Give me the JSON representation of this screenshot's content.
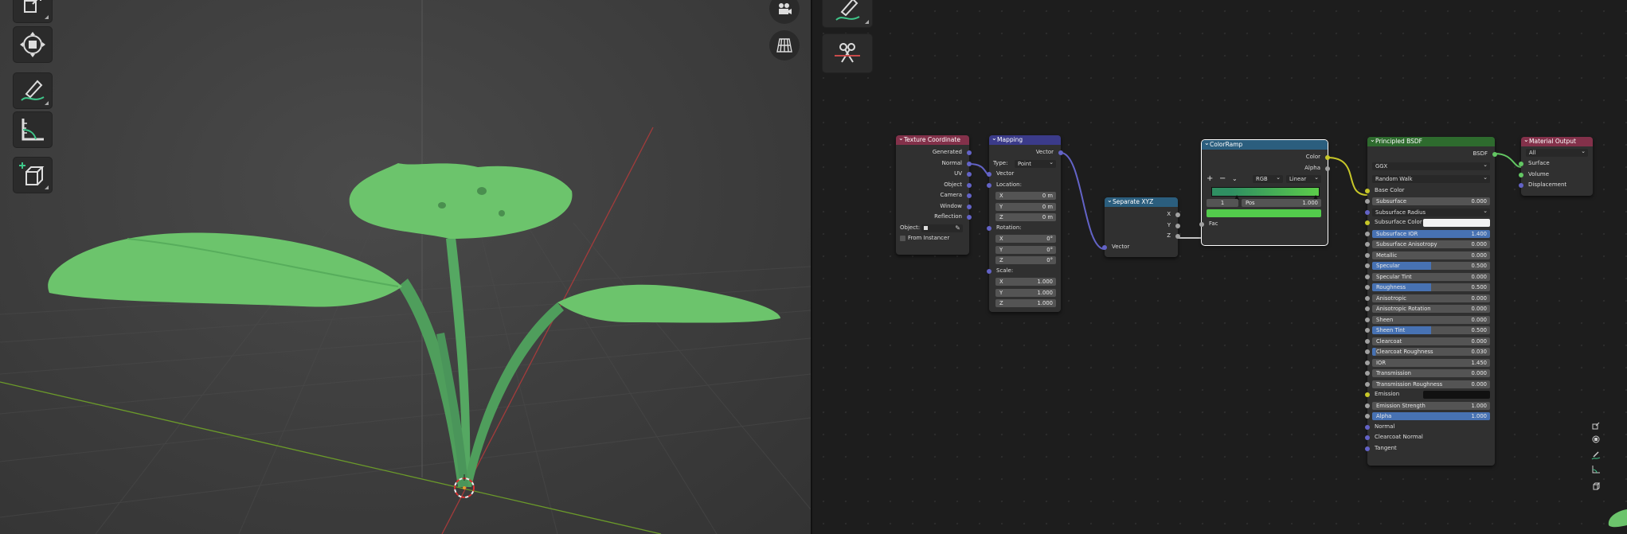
{
  "viewport": {
    "tools": [
      "scale-tool",
      "transform-tool",
      "annotate-tool",
      "measure-tool",
      "add-cube-tool"
    ],
    "nav": [
      "camera-view",
      "perspective-toggle"
    ],
    "colors": {
      "leaf": "#6cc46c",
      "x_axis": "#a33b3b",
      "y_axis": "#6b9a2a",
      "background": "#3d3d3d"
    }
  },
  "node_editor": {
    "texture_coordinate": {
      "title": "Texture Coordinate",
      "outputs": [
        "Generated",
        "Normal",
        "UV",
        "Object",
        "Camera",
        "Window",
        "Reflection"
      ],
      "object_label": "Object:",
      "from_instancer": "From Instancer"
    },
    "mapping": {
      "title": "Mapping",
      "output": "Vector",
      "type_label": "Type:",
      "type_value": "Point",
      "vector_in": "Vector",
      "location_label": "Location:",
      "location": [
        {
          "axis": "X",
          "value": "0 m"
        },
        {
          "axis": "Y",
          "value": "0 m"
        },
        {
          "axis": "Z",
          "value": "0 m"
        }
      ],
      "rotation_label": "Rotation:",
      "rotation": [
        {
          "axis": "X",
          "value": "0°"
        },
        {
          "axis": "Y",
          "value": "0°"
        },
        {
          "axis": "Z",
          "value": "0°"
        }
      ],
      "scale_label": "Scale:",
      "scale": [
        {
          "axis": "X",
          "value": "1.000"
        },
        {
          "axis": "Y",
          "value": "1.000"
        },
        {
          "axis": "Z",
          "value": "1.000"
        }
      ]
    },
    "separate_xyz": {
      "title": "Separate XYZ",
      "outputs": [
        "X",
        "Y",
        "Z"
      ],
      "input": "Vector"
    },
    "color_ramp": {
      "title": "ColorRamp",
      "outputs": [
        "Color",
        "Alpha"
      ],
      "add": "+",
      "remove": "−",
      "color_mode": "RGB",
      "interpolation": "Linear",
      "stop_index": "1",
      "pos_label": "Pos",
      "pos_value": "1.000",
      "input": "Fac",
      "colors": {
        "ramp_start": "#2f8f62",
        "ramp_end": "#5ccc4a",
        "swatch": "#53cc4c"
      }
    },
    "principled_bsdf": {
      "title": "Principled BSDF",
      "output": "BSDF",
      "distribution": "GGX",
      "subsurface_method": "Random Walk",
      "params": [
        {
          "label": "Base Color",
          "value": "",
          "fill": 0,
          "kind": "plain",
          "sock": "yellow"
        },
        {
          "label": "Subsurface",
          "value": "0.000",
          "fill": 0,
          "kind": "field",
          "sock": "grey"
        },
        {
          "label": "Subsurface Radius",
          "value": "",
          "fill": 0,
          "kind": "dropdown",
          "sock": "purple"
        },
        {
          "label": "Subsurface Color",
          "value": "",
          "fill": 0,
          "kind": "color",
          "sock": "yellow"
        },
        {
          "label": "Subsurface IOR",
          "value": "1.400",
          "fill": 1,
          "kind": "field",
          "sock": "grey"
        },
        {
          "label": "Subsurface Anisotropy",
          "value": "0.000",
          "fill": 0,
          "kind": "field",
          "sock": "grey"
        },
        {
          "label": "Metallic",
          "value": "0.000",
          "fill": 0,
          "kind": "field",
          "sock": "grey"
        },
        {
          "label": "Specular",
          "value": "0.500",
          "fill": 0.5,
          "kind": "field",
          "sock": "grey"
        },
        {
          "label": "Specular Tint",
          "value": "0.000",
          "fill": 0,
          "kind": "field",
          "sock": "grey"
        },
        {
          "label": "Roughness",
          "value": "0.500",
          "fill": 0.5,
          "kind": "field",
          "sock": "grey"
        },
        {
          "label": "Anisotropic",
          "value": "0.000",
          "fill": 0,
          "kind": "field",
          "sock": "grey"
        },
        {
          "label": "Anisotropic Rotation",
          "value": "0.000",
          "fill": 0,
          "kind": "field",
          "sock": "grey"
        },
        {
          "label": "Sheen",
          "value": "0.000",
          "fill": 0,
          "kind": "field",
          "sock": "grey"
        },
        {
          "label": "Sheen Tint",
          "value": "0.500",
          "fill": 0.5,
          "kind": "field",
          "sock": "grey"
        },
        {
          "label": "Clearcoat",
          "value": "0.000",
          "fill": 0,
          "kind": "field",
          "sock": "grey"
        },
        {
          "label": "Clearcoat Roughness",
          "value": "0.030",
          "fill": 0.03,
          "kind": "field",
          "sock": "grey"
        },
        {
          "label": "IOR",
          "value": "1.450",
          "fill": 0,
          "kind": "field",
          "sock": "grey"
        },
        {
          "label": "Transmission",
          "value": "0.000",
          "fill": 0,
          "kind": "field",
          "sock": "grey"
        },
        {
          "label": "Transmission Roughness",
          "value": "0.000",
          "fill": 0,
          "kind": "field",
          "sock": "grey"
        },
        {
          "label": "Emission",
          "value": "",
          "fill": 0,
          "kind": "colorblack",
          "sock": "yellow"
        },
        {
          "label": "Emission Strength",
          "value": "1.000",
          "fill": 0,
          "kind": "field",
          "sock": "grey"
        },
        {
          "label": "Alpha",
          "value": "1.000",
          "fill": 1,
          "kind": "field",
          "sock": "grey"
        },
        {
          "label": "Normal",
          "value": "",
          "fill": 0,
          "kind": "plain",
          "sock": "purple"
        },
        {
          "label": "Clearcoat Normal",
          "value": "",
          "fill": 0,
          "kind": "plain",
          "sock": "purple"
        },
        {
          "label": "Tangent",
          "value": "",
          "fill": 0,
          "kind": "plain",
          "sock": "purple"
        }
      ]
    },
    "material_output": {
      "title": "Material Output",
      "target": "All",
      "inputs": [
        "Surface",
        "Volume",
        "Displacement"
      ]
    }
  }
}
